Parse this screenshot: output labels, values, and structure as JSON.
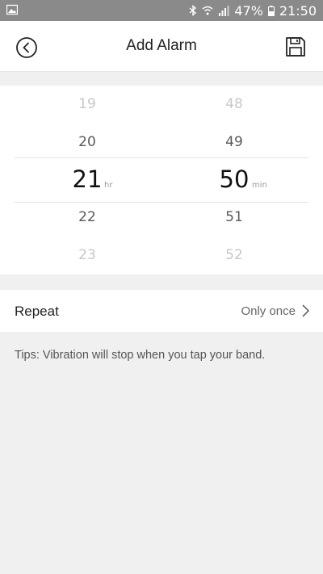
{
  "status_bar": {
    "battery": "47%",
    "time": "21:50",
    "icons": [
      "image-icon",
      "bluetooth-icon",
      "wifi-icon",
      "signal-icon",
      "battery-icon"
    ]
  },
  "header": {
    "title": "Add Alarm",
    "back_icon": "back-circle-icon",
    "save_icon": "save-icon"
  },
  "picker": {
    "hours": {
      "values": [
        "19",
        "20",
        "21",
        "22",
        "23"
      ],
      "selected": "21",
      "unit": "hr"
    },
    "minutes": {
      "values": [
        "48",
        "49",
        "50",
        "51",
        "52"
      ],
      "selected": "50",
      "unit": "min"
    }
  },
  "repeat": {
    "label": "Repeat",
    "value": "Only once"
  },
  "tips": "Tips: Vibration will stop when you tap your band.",
  "colors": {
    "status_bar": "#8a8a8a",
    "background": "#f0f0f0",
    "selected_text": "#111111",
    "faded_text": "#c8c8c8"
  }
}
